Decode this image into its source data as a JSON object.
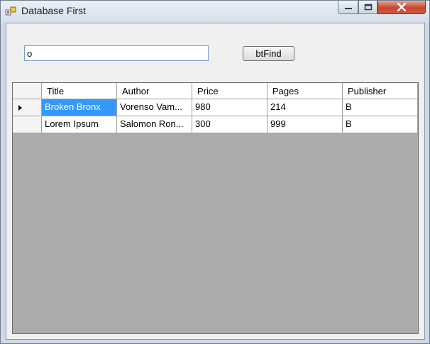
{
  "window": {
    "title": "Database First"
  },
  "search": {
    "value": "o"
  },
  "toolbar": {
    "find_label": "btFind"
  },
  "grid": {
    "columns": [
      "Title",
      "Author",
      "Price",
      "Pages",
      "Publisher"
    ],
    "rows": [
      {
        "title": "Broken Bronx",
        "author": "Vorenso Vam...",
        "price": "980",
        "pages": "214",
        "publisher": "B"
      },
      {
        "title": "Lorem Ipsum",
        "author": "Salomon Ron...",
        "price": "300",
        "pages": "999",
        "publisher": "B"
      }
    ],
    "selected_cell_color": "#3399ff"
  },
  "icons": [
    "app-icon",
    "minimize-icon",
    "maximize-icon",
    "close-icon",
    "current-row-arrow-icon"
  ]
}
